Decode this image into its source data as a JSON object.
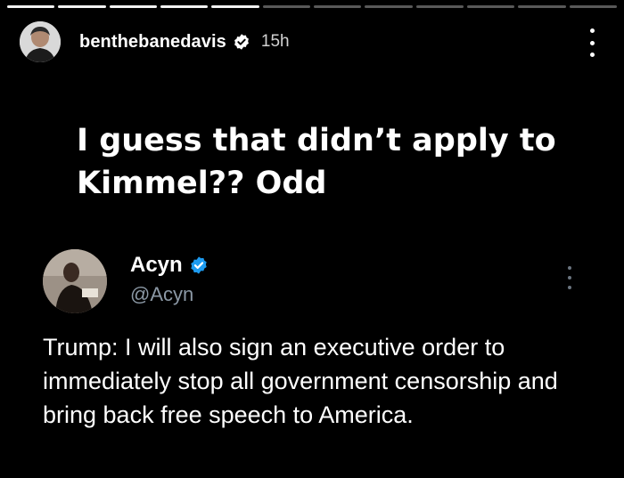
{
  "story": {
    "progress_segments": 12,
    "progress_seen": 5,
    "username": "benthebanedavis",
    "time_ago": "15h",
    "caption": "I guess that didn’t apply to Kimmel?? Odd"
  },
  "tweet": {
    "name": "Acyn",
    "handle": "@Acyn",
    "body": "Trump: I will also sign an executive order to immediately stop all government censorship and bring back free speech to America."
  },
  "colors": {
    "background": "#000000",
    "verified_blue": "#1d9bf0",
    "handle_gray": "#8b98a5"
  },
  "icons": {
    "story_verified": "verified-badge-icon",
    "tweet_verified": "verified-badge-icon",
    "story_more": "more-vertical-icon",
    "tweet_more": "more-vertical-icon"
  }
}
